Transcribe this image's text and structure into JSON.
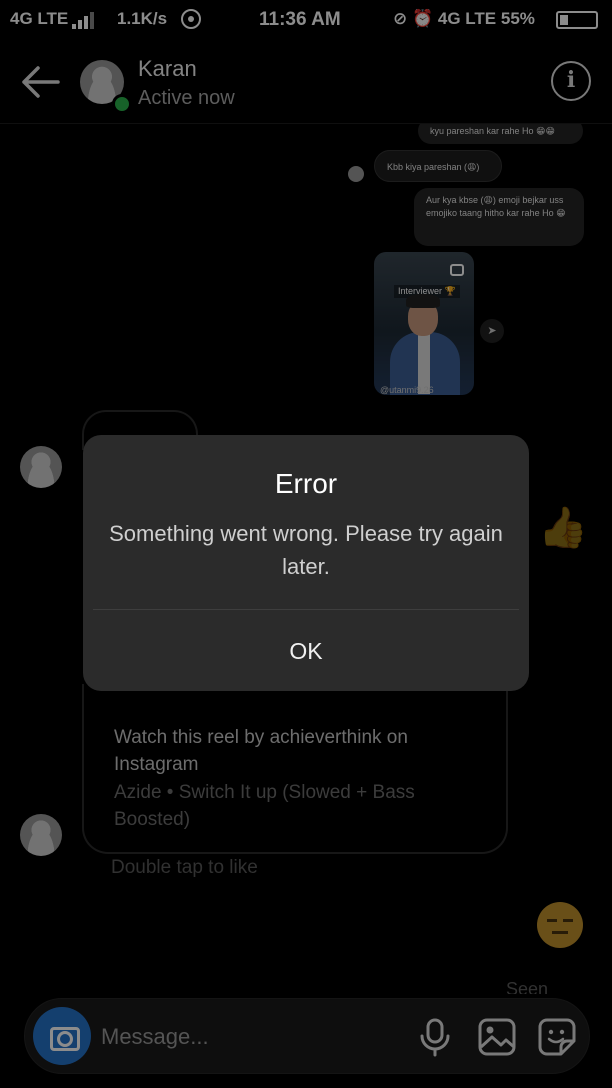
{
  "status_bar": {
    "network": "4G LTE",
    "speed": "1.1K/s",
    "time": "11:36 AM",
    "network_right": "4G LTE",
    "battery": "55%"
  },
  "header": {
    "contact_name": "Karan",
    "contact_status": "Active now",
    "info_icon": "i"
  },
  "messages": {
    "m1": "kyu pareshan kar rahe Ho 😁😁",
    "m2": "Kbb kiya pareshan (😩)",
    "m3": "Aur kya kbse (😩) emoji bejkar uss emojiko taang hitho kar rahe Ho 😁",
    "reel_tag": "Interviewer 🏆",
    "reel_user": "@utanmi9.26"
  },
  "post": {
    "title": "Watch this reel by achieverthink on Instagram",
    "subtitle": "Azide • Switch It up (Slowed + Bass Boosted)"
  },
  "double_tap": "Double tap to like",
  "seen": "Seen",
  "composer": {
    "placeholder": "Message..."
  },
  "dialog": {
    "title": "Error",
    "message": "Something went wrong. Please try again later.",
    "ok": "OK"
  },
  "colors": {
    "online": "#2ab24b",
    "camera_button": "#2673c9",
    "dialog_bg": "#2b2b2b"
  }
}
